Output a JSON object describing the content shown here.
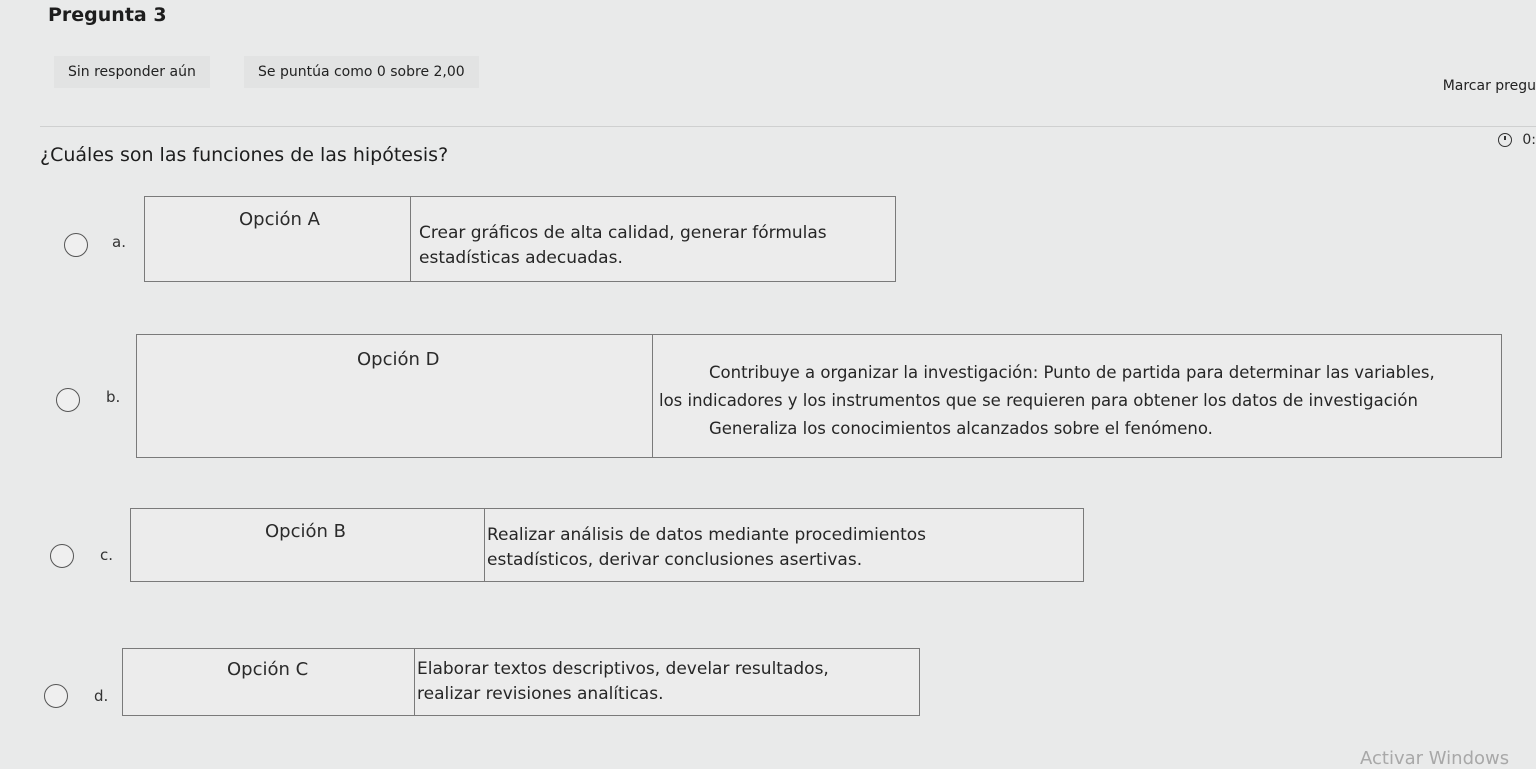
{
  "header": {
    "title": "Pregunta 3",
    "state": "Sin responder aún",
    "grade": "Se puntúa como 0 sobre 2,00",
    "flag_label": "Marcar pregu",
    "timer_text": "0:"
  },
  "question": {
    "text": "¿Cuáles son las funciones de las hipótesis?"
  },
  "options": [
    {
      "letter": "a.",
      "name": "Opción A",
      "lines": [
        "Crear gráficos de alta calidad, generar fórmulas",
        "estadísticas adecuadas."
      ]
    },
    {
      "letter": "b.",
      "name": "Opción D",
      "lines": [
        "Contribuye a organizar la investigación: Punto de partida para determinar las variables,",
        "los indicadores y los instrumentos que se requieren para obtener los datos de investigación",
        "Generaliza los conocimientos alcanzados sobre el fenómeno."
      ]
    },
    {
      "letter": "c.",
      "name": "Opción B",
      "lines": [
        "Realizar análisis de datos mediante procedimientos",
        "estadísticos, derivar conclusiones asertivas."
      ]
    },
    {
      "letter": "d.",
      "name": "Opción C",
      "lines": [
        "Elaborar textos descriptivos, develar resultados,",
        "realizar revisiones analíticas."
      ]
    }
  ],
  "os": {
    "watermark": "Activar Windows"
  }
}
